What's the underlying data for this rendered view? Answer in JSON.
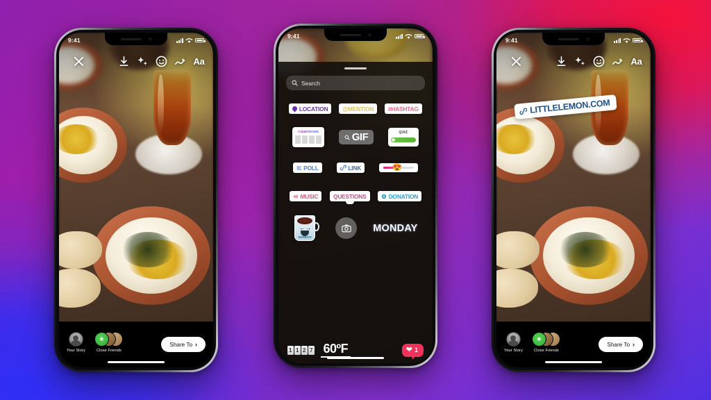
{
  "background": {
    "gradient_colors": [
      "#8e1fb0",
      "#f4123a",
      "#2f2ef5",
      "#a3269c"
    ]
  },
  "phones": {
    "left": {
      "status": {
        "time": "9:41",
        "signal_icon": "cellular-bars-icon",
        "wifi_icon": "wifi-icon",
        "battery_icon": "battery-icon"
      },
      "toolbar": {
        "close_label": "✕",
        "items": [
          "close-icon",
          "download-icon",
          "sparkles-icon",
          "sticker-icon",
          "draw-icon",
          "text-icon"
        ],
        "text_label": "Aa"
      },
      "bottom": {
        "your_story_label": "Your Story",
        "close_friends_label": "Close Friends",
        "share_label": "Share To",
        "share_chevron": "›"
      }
    },
    "middle": {
      "status": {
        "time": "9:41"
      },
      "search": {
        "placeholder": "Search",
        "icon": "search-icon"
      },
      "stickers": {
        "row1": [
          {
            "label": "LOCATION",
            "icon": "location-pin-icon",
            "color": "#6a2fb5"
          },
          {
            "label": "@MENTION",
            "color": "#e0c35c"
          },
          {
            "label": "#HASHTAG",
            "color": "#e06a86"
          }
        ],
        "row2": {
          "countdown": {
            "title": "COUNTDOWN",
            "digit_count": 4
          },
          "gif": {
            "label": "GIF",
            "icon": "search-icon"
          },
          "quiz": {
            "title": "QUIZ"
          }
        },
        "row3": [
          {
            "label": "POLL",
            "color": "#4f7fd1"
          },
          {
            "label": "LINK",
            "icon": "link-icon",
            "color": "#2f6fb5"
          },
          {
            "label": "emoji-slider",
            "emoji": "😍"
          }
        ],
        "row4": [
          {
            "label": "MUSIC",
            "icon": "music-wave-icon",
            "color": "#d05a7a"
          },
          {
            "label": "QUESTIONS",
            "color": "#c94f87"
          },
          {
            "label": "DONATION",
            "icon": "donation-icon",
            "color": "#2f9fd1"
          }
        ],
        "row5": {
          "mug": {
            "face": "← →",
            "label": "MONDAY"
          },
          "camera": {
            "icon": "camera-icon"
          },
          "day": {
            "label": "MONDAY"
          }
        }
      },
      "tray_bottom": {
        "counter_digits": [
          "1",
          "1",
          "2",
          "7"
        ],
        "temperature": "60ºF",
        "heart": {
          "icon": "heart-icon",
          "count": "1",
          "color": "#f0335a"
        }
      }
    },
    "right": {
      "status": {
        "time": "9:41"
      },
      "toolbar": {
        "text_label": "Aa"
      },
      "link_sticker": {
        "text": "LITTLELEMON.COM",
        "icon": "link-icon",
        "color": "#1b4f8a"
      },
      "bottom": {
        "your_story_label": "Your Story",
        "close_friends_label": "Close Friends",
        "share_label": "Share To",
        "share_chevron": "›"
      }
    }
  }
}
